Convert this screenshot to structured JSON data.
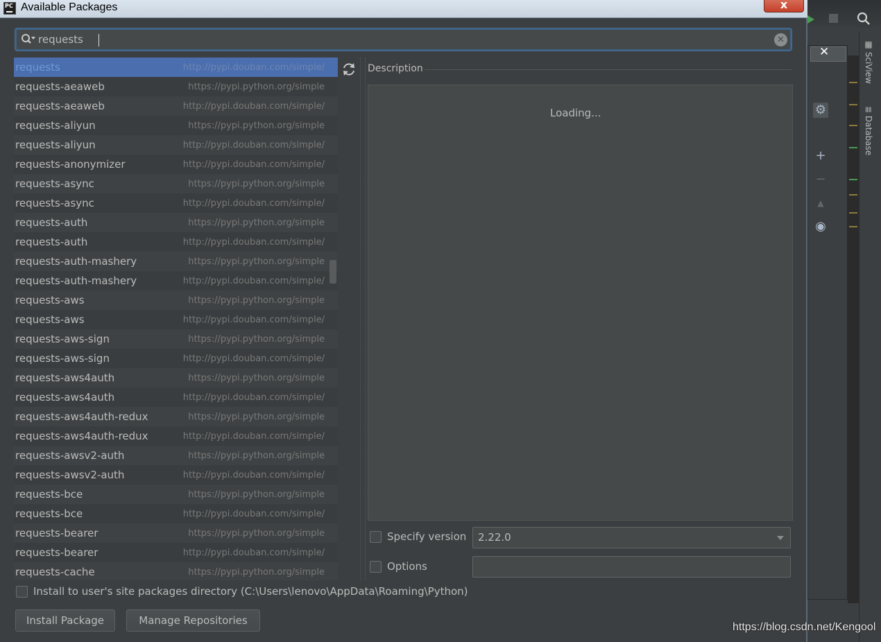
{
  "window": {
    "title": "Available Packages",
    "app_icon_text": "PC",
    "close_glyph": "x"
  },
  "search": {
    "value": "requests",
    "icon": "search-icon",
    "clear_icon": "clear-icon"
  },
  "packages": [
    {
      "name": "requests",
      "repo": "http://pypi.douban.com/simple/",
      "selected": true
    },
    {
      "name": "requests-aeaweb",
      "repo": "https://pypi.python.org/simple"
    },
    {
      "name": "requests-aeaweb",
      "repo": "http://pypi.douban.com/simple/"
    },
    {
      "name": "requests-aliyun",
      "repo": "https://pypi.python.org/simple"
    },
    {
      "name": "requests-aliyun",
      "repo": "http://pypi.douban.com/simple/"
    },
    {
      "name": "requests-anonymizer",
      "repo": "http://pypi.douban.com/simple/"
    },
    {
      "name": "requests-async",
      "repo": "https://pypi.python.org/simple"
    },
    {
      "name": "requests-async",
      "repo": "http://pypi.douban.com/simple/"
    },
    {
      "name": "requests-auth",
      "repo": "https://pypi.python.org/simple"
    },
    {
      "name": "requests-auth",
      "repo": "http://pypi.douban.com/simple/"
    },
    {
      "name": "requests-auth-mashery",
      "repo": "https://pypi.python.org/simple"
    },
    {
      "name": "requests-auth-mashery",
      "repo": "http://pypi.douban.com/simple/"
    },
    {
      "name": "requests-aws",
      "repo": "https://pypi.python.org/simple"
    },
    {
      "name": "requests-aws",
      "repo": "http://pypi.douban.com/simple/"
    },
    {
      "name": "requests-aws-sign",
      "repo": "https://pypi.python.org/simple"
    },
    {
      "name": "requests-aws-sign",
      "repo": "http://pypi.douban.com/simple/"
    },
    {
      "name": "requests-aws4auth",
      "repo": "https://pypi.python.org/simple"
    },
    {
      "name": "requests-aws4auth",
      "repo": "http://pypi.douban.com/simple/"
    },
    {
      "name": "requests-aws4auth-redux",
      "repo": "https://pypi.python.org/simple"
    },
    {
      "name": "requests-aws4auth-redux",
      "repo": "http://pypi.douban.com/simple/"
    },
    {
      "name": "requests-awsv2-auth",
      "repo": "https://pypi.python.org/simple"
    },
    {
      "name": "requests-awsv2-auth",
      "repo": "http://pypi.douban.com/simple/"
    },
    {
      "name": "requests-bce",
      "repo": "https://pypi.python.org/simple"
    },
    {
      "name": "requests-bce",
      "repo": "http://pypi.douban.com/simple/"
    },
    {
      "name": "requests-bearer",
      "repo": "https://pypi.python.org/simple"
    },
    {
      "name": "requests-bearer",
      "repo": "http://pypi.douban.com/simple/"
    },
    {
      "name": "requests-cache",
      "repo": "https://pypi.python.org/simple"
    }
  ],
  "description": {
    "label": "Description",
    "loading_text": "Loading..."
  },
  "specify_version": {
    "label": "Specify version",
    "checked": false,
    "value": "2.22.0"
  },
  "options": {
    "label": "Options",
    "checked": false,
    "value": ""
  },
  "install_to_user": {
    "label": "Install to user's site packages directory (C:\\Users\\lenovo\\AppData\\Roaming\\Python)",
    "checked": false
  },
  "buttons": {
    "install": "Install Package",
    "manage": "Manage Repositories"
  },
  "ide": {
    "side_tabs": [
      "SciView",
      "Database"
    ],
    "watermark": "https://blog.csdn.net/Kengool"
  },
  "colors": {
    "selection": "#4b6eaf",
    "focus_border": "#3d6185",
    "dialog_bg": "#3c3f41"
  }
}
